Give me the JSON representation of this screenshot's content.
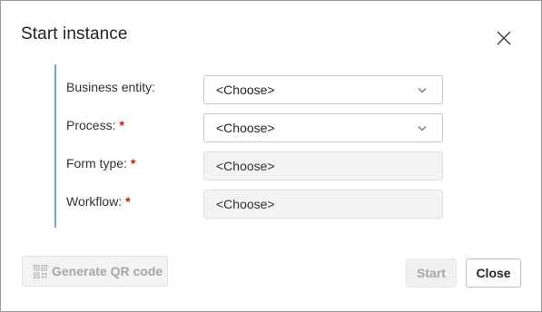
{
  "dialog": {
    "title": "Start instance",
    "close_icon": "close-icon"
  },
  "form": {
    "fields": [
      {
        "label": "Business entity:",
        "required": false,
        "value": "<Choose>",
        "enabled": true,
        "dropdown": true
      },
      {
        "label": "Process:",
        "required": true,
        "value": "<Choose>",
        "enabled": true,
        "dropdown": true
      },
      {
        "label": "Form type:",
        "required": true,
        "value": "<Choose>",
        "enabled": false,
        "dropdown": false
      },
      {
        "label": "Workflow:",
        "required": true,
        "value": "<Choose>",
        "enabled": false,
        "dropdown": false
      }
    ],
    "required_marker": "*"
  },
  "footer": {
    "qr_button_label": "Generate QR code",
    "qr_icon": "qr-code-icon",
    "start_label": "Start",
    "close_label": "Close"
  },
  "colors": {
    "accent_bar": "#6aa7c6",
    "required": "#c4161c",
    "disabled_bg": "#f3f3f3"
  }
}
